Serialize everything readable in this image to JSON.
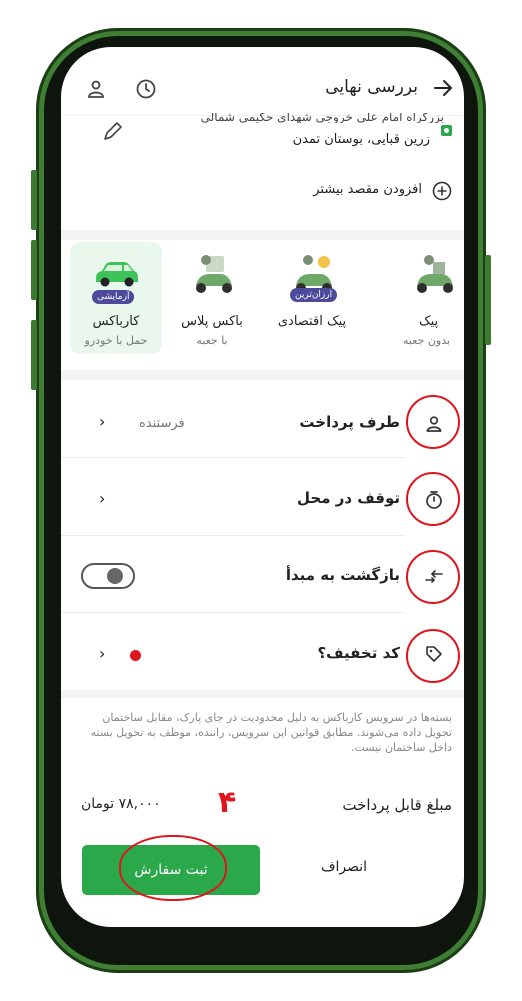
{
  "header": {
    "title": "بررسی نهایی",
    "back_icon": "arrow-right-icon",
    "history_icon": "clock-icon",
    "profile_icon": "user-icon"
  },
  "destination": {
    "partial_line": "بزرگراه امام علی  خروجی شهدای حکیمی  شمالی",
    "address": "زرین قبایی، بوستان تمدن",
    "add_more": "افزودن مقصد بیشتر"
  },
  "vehicles": [
    {
      "name": "کارباکس",
      "sub": "حمل با خودرو",
      "badge": "آزمایشی",
      "icon": "car-icon",
      "selected": true
    },
    {
      "name": "باکس پلاس",
      "sub": "با جعبه",
      "badge": "",
      "icon": "scooter-icon",
      "selected": false
    },
    {
      "name": "پیک اقتصادی",
      "sub": "",
      "badge": "ارزان‌ترین",
      "icon": "scooter-icon",
      "selected": false
    },
    {
      "name": "پیک",
      "sub": "بدون جعبه",
      "badge": "",
      "icon": "scooter-icon",
      "selected": false
    }
  ],
  "options": {
    "payer_label": "طرف پرداخت",
    "payer_value": "فرستنده",
    "stop_label": "توقف در محل",
    "return_label": "بازگشت به مبدأ",
    "discount_label": "کد تخفیف؟"
  },
  "notice": "بسته‌ها در سرویس کارباکس به دلیل محدودیت در جای پارک، مقابل ساختمان تحویل داده می‌شوند. مطابق قوانین این سرویس، راننده، موظف به تحویل بسته داخل ساختمان نیست.",
  "payment": {
    "label": "مبلغ قابل پرداخت",
    "amount": "۷۸,۰۰۰ تومان"
  },
  "actions": {
    "submit": "ثبت سفارش",
    "cancel": "انصراف"
  },
  "annotation_number": "۴",
  "colors": {
    "accent_green": "#2aa84a",
    "annotation_red": "#e0141b",
    "phone_frame": "#3f7f34"
  }
}
